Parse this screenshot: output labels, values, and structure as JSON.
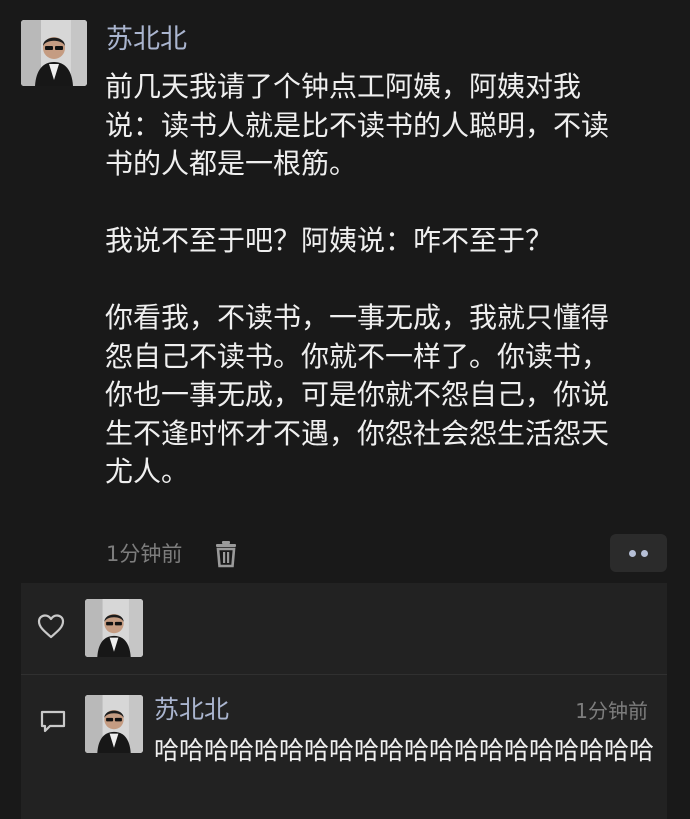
{
  "post": {
    "author": "苏北北",
    "paragraphs": [
      "前几天我请了个钟点工阿姨，阿姨对我\n说：读书人就是比不读书的人聪明，不读\n书的人都是一根筋。",
      "我说不至于吧？阿姨说：咋不至于？",
      "你看我，不读书，一事无成，我就只懂得\n怨自己不读书。你就不一样了。你读书，\n你也一事无成，可是你就不怨自己，你说\n生不逢时怀才不遇，你怨社会怨生活怨天\n尤人。"
    ],
    "time": "1分钟前",
    "icons": {
      "avatar": "avatar-photo",
      "delete": "trash-icon",
      "more": "more-dots-icon"
    }
  },
  "interactions": {
    "like_icon": "heart-icon",
    "comment_icon": "comment-icon",
    "comment": {
      "author": "苏北北",
      "time": "1分钟前",
      "text": "哈哈哈哈哈哈哈哈哈哈哈哈哈哈哈哈哈哈哈哈"
    }
  },
  "colors": {
    "background": "#191919",
    "panel": "#222222",
    "name": "#aab5cf",
    "text": "#efefef",
    "meta": "#7d7d7d"
  }
}
